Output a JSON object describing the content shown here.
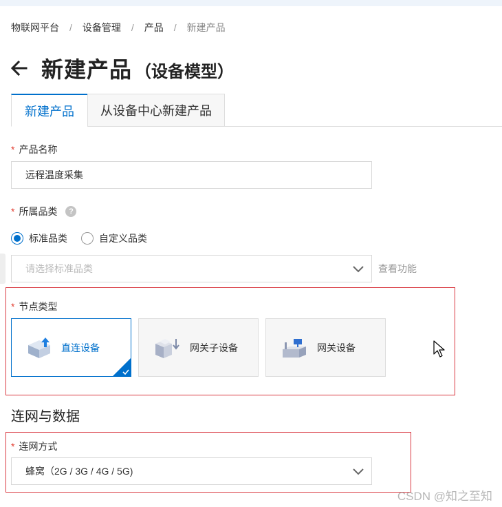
{
  "breadcrumb": {
    "items": [
      "物联网平台",
      "设备管理",
      "产品",
      "新建产品"
    ],
    "separator": "/"
  },
  "page": {
    "title": "新建产品",
    "subtitle": "（设备模型）"
  },
  "tabs": [
    {
      "label": "新建产品",
      "active": true
    },
    {
      "label": "从设备中心新建产品",
      "active": false
    }
  ],
  "form": {
    "required_mark": "*",
    "product_name": {
      "label": "产品名称",
      "value": "远程温度采集"
    },
    "category": {
      "label": "所属品类",
      "help_icon": "question-circle-icon",
      "options": [
        {
          "label": "标准品类",
          "selected": true
        },
        {
          "label": "自定义品类",
          "selected": false
        }
      ],
      "select_placeholder": "请选择标准品类",
      "view_features_label": "查看功能"
    },
    "node_type": {
      "label": "节点类型",
      "options": [
        {
          "label": "直连设备",
          "icon": "direct-device-icon",
          "selected": true
        },
        {
          "label": "网关子设备",
          "icon": "gateway-subdevice-icon",
          "selected": false
        },
        {
          "label": "网关设备",
          "icon": "gateway-device-icon",
          "selected": false
        }
      ]
    },
    "section_title": "连网与数据",
    "network": {
      "label": "连网方式",
      "value": "蜂窝（2G / 3G / 4G / 5G)"
    }
  },
  "watermark": "CSDN @知之至知",
  "colors": {
    "accent": "#0070cc",
    "required": "#e23b2e",
    "highlight_box": "#d9363e"
  }
}
